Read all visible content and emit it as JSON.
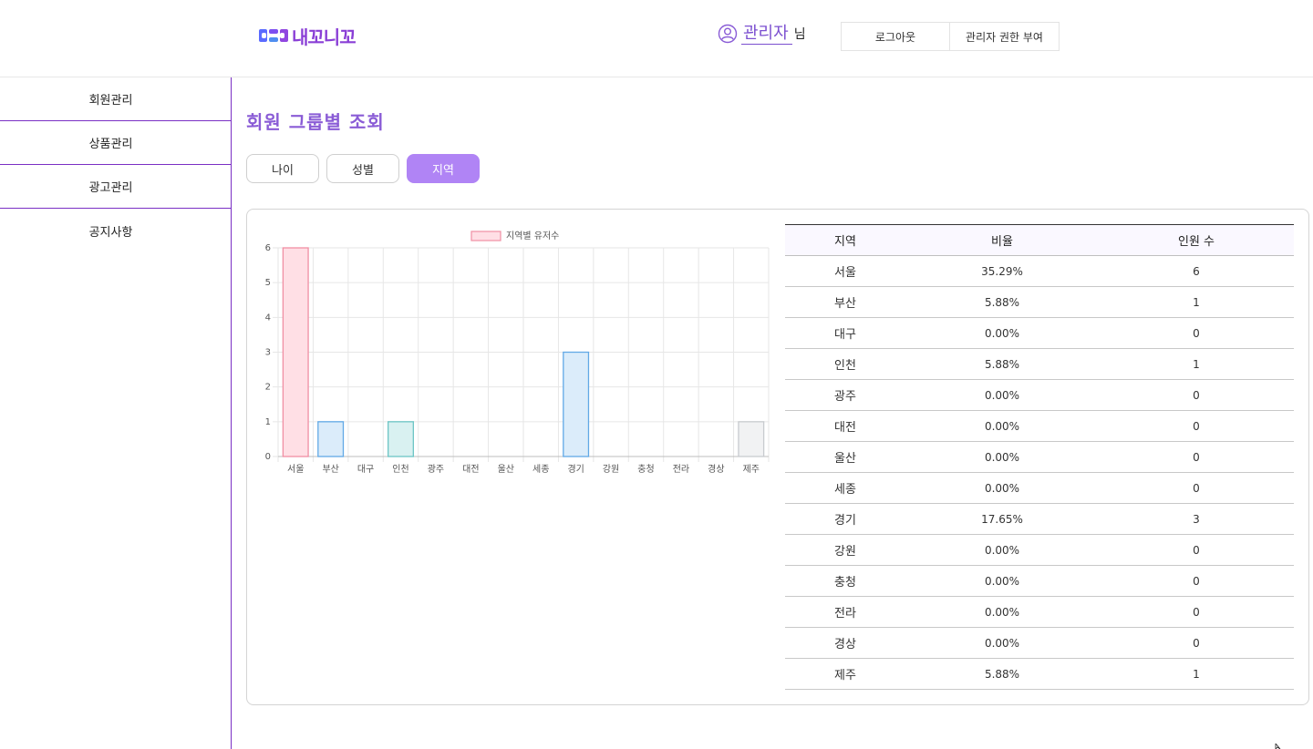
{
  "header": {
    "brand": "내꼬니꼬",
    "user_name": "관리자",
    "user_suffix": "님",
    "logout_label": "로그아웃",
    "grant_admin_label": "관리자 권한 부여"
  },
  "sidebar": {
    "items": [
      {
        "label": "회원관리"
      },
      {
        "label": "상품관리"
      },
      {
        "label": "광고관리"
      },
      {
        "label": "공지사항"
      }
    ]
  },
  "main": {
    "title": "회원 그룹별 조회",
    "tabs": [
      {
        "label": "나이",
        "active": false
      },
      {
        "label": "성별",
        "active": false
      },
      {
        "label": "지역",
        "active": true
      }
    ]
  },
  "table": {
    "headers": [
      "지역",
      "비율",
      "인원 수"
    ],
    "rows": [
      {
        "region": "서울",
        "ratio": "35.29%",
        "count": "6"
      },
      {
        "region": "부산",
        "ratio": "5.88%",
        "count": "1"
      },
      {
        "region": "대구",
        "ratio": "0.00%",
        "count": "0"
      },
      {
        "region": "인천",
        "ratio": "5.88%",
        "count": "1"
      },
      {
        "region": "광주",
        "ratio": "0.00%",
        "count": "0"
      },
      {
        "region": "대전",
        "ratio": "0.00%",
        "count": "0"
      },
      {
        "region": "울산",
        "ratio": "0.00%",
        "count": "0"
      },
      {
        "region": "세종",
        "ratio": "0.00%",
        "count": "0"
      },
      {
        "region": "경기",
        "ratio": "17.65%",
        "count": "3"
      },
      {
        "region": "강원",
        "ratio": "0.00%",
        "count": "0"
      },
      {
        "region": "충청",
        "ratio": "0.00%",
        "count": "0"
      },
      {
        "region": "전라",
        "ratio": "0.00%",
        "count": "0"
      },
      {
        "region": "경상",
        "ratio": "0.00%",
        "count": "0"
      },
      {
        "region": "제주",
        "ratio": "5.88%",
        "count": "1"
      }
    ]
  },
  "colors": {
    "accent": "#b084f5",
    "title": "#8a5cd6",
    "divider": "#7a2fc4",
    "bar_fills": [
      "#ffdfe5",
      "#dbecfa",
      "#dbecfa",
      "#d9f1f1",
      "#dbecfa",
      "#dbecfa",
      "#dbecfa",
      "#dbecfa",
      "#dbecfa",
      "#dbecfa",
      "#dbecfa",
      "#dbecfa",
      "#dbecfa",
      "#f1f2f3"
    ],
    "bar_strokes": [
      "#f08fa3",
      "#62a9e6",
      "#62a9e6",
      "#6cc5c5",
      "#62a9e6",
      "#62a9e6",
      "#62a9e6",
      "#62a9e6",
      "#62a9e6",
      "#62a9e6",
      "#62a9e6",
      "#62a9e6",
      "#62a9e6",
      "#c8cbcf"
    ]
  },
  "icons": {
    "user": "user-circle-icon",
    "logo": "logo-icon"
  },
  "chart_data": {
    "type": "bar",
    "categories": [
      "서울",
      "부산",
      "대구",
      "인천",
      "광주",
      "대전",
      "울산",
      "세종",
      "경기",
      "강원",
      "충청",
      "전라",
      "경상",
      "제주"
    ],
    "series": [
      {
        "name": "지역별 유저수",
        "values": [
          6,
          1,
          0,
          1,
          0,
          0,
          0,
          0,
          3,
          0,
          0,
          0,
          0,
          1
        ]
      }
    ],
    "ylim": [
      0,
      6
    ],
    "yticks": [
      0,
      1,
      2,
      3,
      4,
      5,
      6
    ],
    "grid": true,
    "legend": "top-center"
  }
}
